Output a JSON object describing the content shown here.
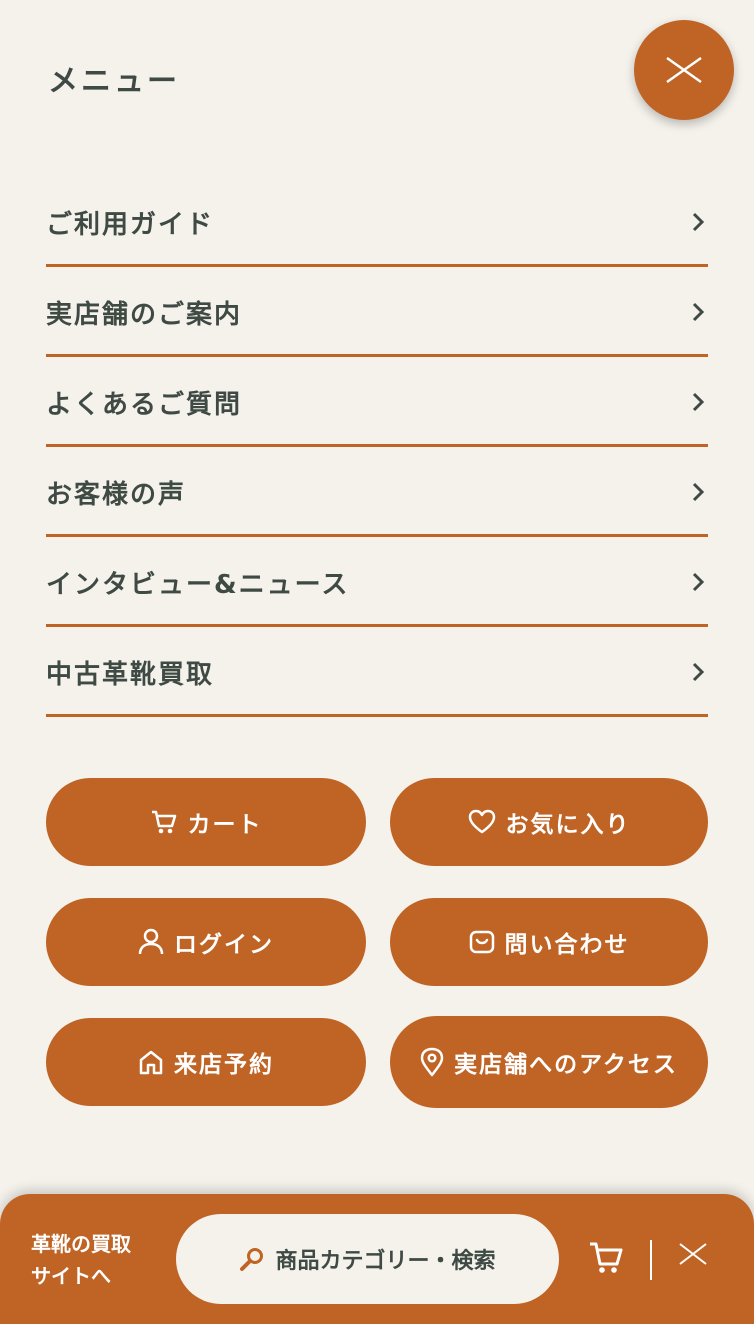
{
  "header": {
    "title": "メニュー"
  },
  "menu": [
    {
      "label": "ご利用ガイド"
    },
    {
      "label": "実店舗のご案内"
    },
    {
      "label": "よくあるご質問"
    },
    {
      "label": "お客様の声"
    },
    {
      "label": "インタビュー&ニュース"
    },
    {
      "label": "中古革靴買取"
    }
  ],
  "buttons": {
    "cart": "カート",
    "favorites": "お気に入り",
    "login": "ログイン",
    "contact": "問い合わせ",
    "reservation": "来店予約",
    "access": "実店舗へのアクセス"
  },
  "bottom_bar": {
    "buy_line1": "革靴の買取",
    "buy_line2": "サイトへ",
    "search_label": "商品カテゴリー・検索"
  },
  "colors": {
    "accent": "#c06426",
    "background": "#f5f2ec",
    "text": "#3f4a45"
  }
}
